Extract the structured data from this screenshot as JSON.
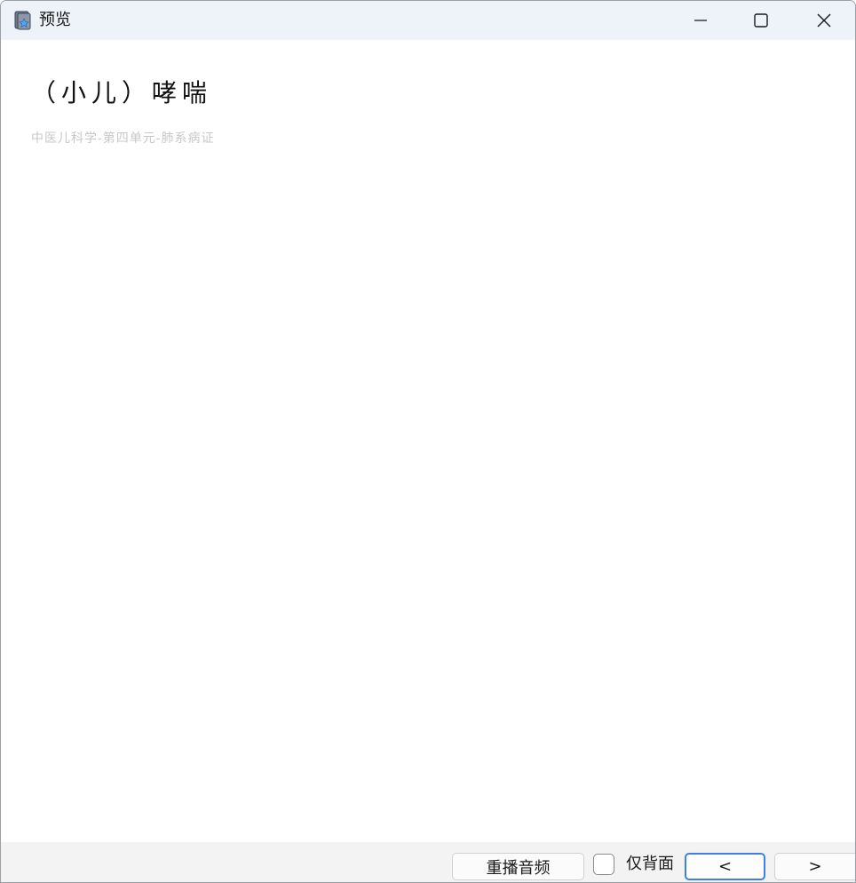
{
  "window": {
    "title": "预览",
    "icon": "app-icon",
    "controls": {
      "minimize": "minimize-icon",
      "maximize": "maximize-icon",
      "close": "close-icon"
    }
  },
  "card": {
    "front": "（小儿）哮喘",
    "tag": "中医儿科学-第四单元-肺系病证"
  },
  "toolbar": {
    "replay_audio": "重播音频",
    "back_only_label": "仅背面",
    "back_only_checked": false,
    "prev": "<",
    "next": ">"
  },
  "colors": {
    "titlebar_bg": "#eef2f9",
    "accent": "#3f7ee8",
    "tag_text": "#c8c8c8"
  }
}
